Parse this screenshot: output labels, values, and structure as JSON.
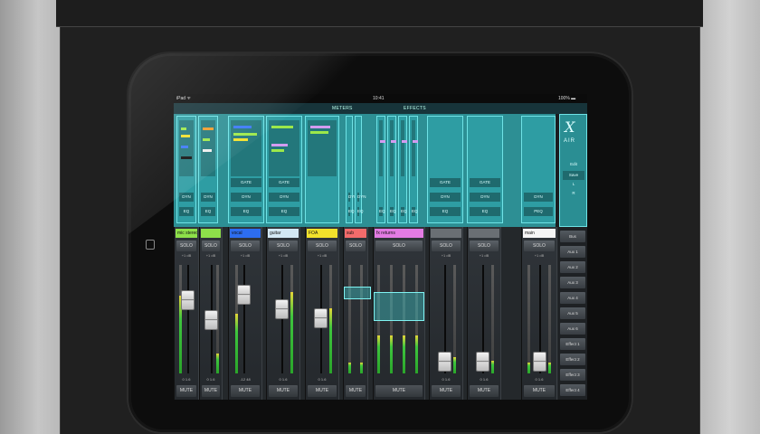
{
  "status_bar": {
    "device": "iPad ᯤ",
    "time": "10:41",
    "battery": "100% ▬"
  },
  "toolbar": {
    "meters_label": "METERS",
    "effects_label": "EFFECTS"
  },
  "logo": {
    "mark": "X",
    "name": "AIR"
  },
  "overview_sidebar": [
    "Edit",
    "Save",
    "L",
    "R"
  ],
  "overview_buttons": {
    "gate": "GATE",
    "dyn": "DYN",
    "eq": "EQ",
    "peq": "PEQ"
  },
  "channels": [
    {
      "name": "mic stereo",
      "color": "#8ee04a",
      "solo": "SOLO",
      "mute": "MUTE",
      "gain": "+1 dB",
      "db": "0   1.6"
    },
    {
      "name": "",
      "color": "#8ee04a",
      "solo": "SOLO",
      "mute": "MUTE",
      "gain": "+1 dB",
      "db": "0   1.6"
    },
    {
      "name": "vocal",
      "color": "#2d6df0",
      "solo": "SOLO",
      "mute": "MUTE",
      "gain": "+1 dB",
      "db": "-12  48"
    },
    {
      "name": "guitar",
      "color": "#d3e8f4",
      "solo": "SOLO",
      "mute": "MUTE",
      "gain": "+1 dB",
      "db": "0   1.6"
    },
    {
      "name": "FOA",
      "color": "#f2e12b",
      "solo": "SOLO",
      "mute": "MUTE",
      "gain": "+1 dB",
      "db": "0   1.6"
    },
    {
      "name": "sub",
      "color": "#f26b6b",
      "solo": "SOLO",
      "mute": "MUTE",
      "gain": "",
      "db": ""
    },
    {
      "name": "fx returns",
      "color": "#e37be3",
      "solo": "SOLO",
      "mute": "MUTE",
      "gain": "",
      "db": ""
    },
    {
      "name": "",
      "color": "#6a6f74",
      "solo": "SOLO",
      "mute": "MUTE",
      "gain": "+1 dB",
      "db": "0   1.6"
    },
    {
      "name": "",
      "color": "#6a6f74",
      "solo": "SOLO",
      "mute": "MUTE",
      "gain": "+1 dB",
      "db": "0   1.6"
    },
    {
      "name": "main",
      "color": "#f5f5f5",
      "solo": "SOLO",
      "mute": "MUTE",
      "gain": "+1 dB",
      "db": "0   1.6"
    }
  ],
  "right_column": [
    "Bus",
    "Aux 1",
    "Aux 2",
    "Aux 3",
    "Aux 4",
    "Aux 5",
    "Aux 6",
    "Effect 1",
    "Effect 2",
    "Effect 3",
    "Effect 4"
  ]
}
